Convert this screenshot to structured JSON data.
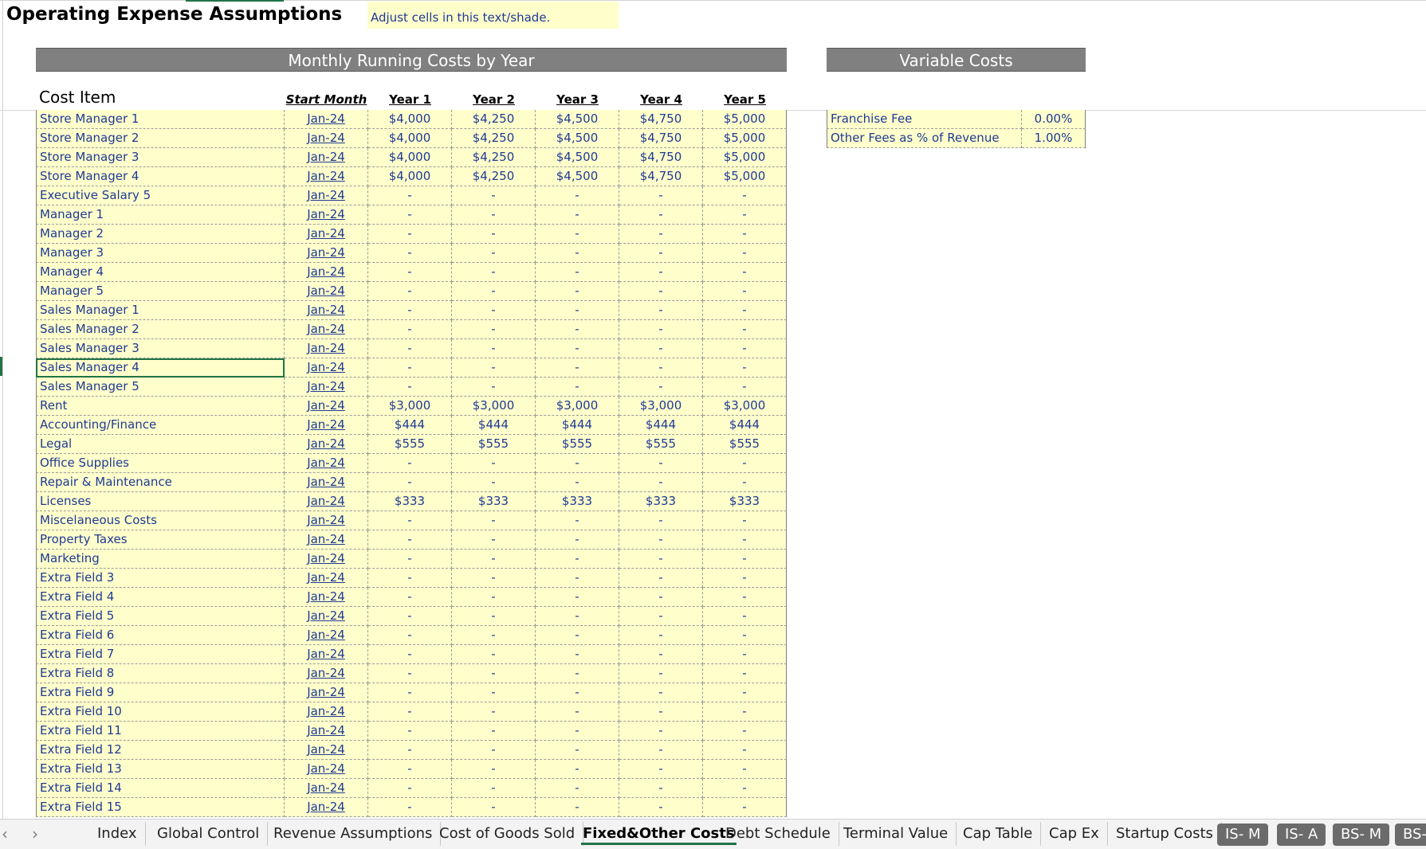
{
  "title": "Operating Expense Assumptions",
  "note": "Adjust cells in this text/shade.",
  "main_header": "Monthly Running Costs by Year",
  "variable_header": "Variable Costs",
  "columns": {
    "cost_item": "Cost Item",
    "start_month": "Start Month",
    "years": [
      "Year 1",
      "Year 2",
      "Year 3",
      "Year 4",
      "Year 5"
    ]
  },
  "rows": [
    {
      "name": "Store Manager 1",
      "start": "Jan-24",
      "values": [
        "$4,000",
        "$4,250",
        "$4,500",
        "$4,750",
        "$5,000"
      ]
    },
    {
      "name": "Store Manager 2",
      "start": "Jan-24",
      "values": [
        "$4,000",
        "$4,250",
        "$4,500",
        "$4,750",
        "$5,000"
      ]
    },
    {
      "name": "Store Manager 3",
      "start": "Jan-24",
      "values": [
        "$4,000",
        "$4,250",
        "$4,500",
        "$4,750",
        "$5,000"
      ]
    },
    {
      "name": "Store Manager 4",
      "start": "Jan-24",
      "values": [
        "$4,000",
        "$4,250",
        "$4,500",
        "$4,750",
        "$5,000"
      ]
    },
    {
      "name": "Executive Salary 5",
      "start": "Jan-24",
      "values": [
        "-",
        "-",
        "-",
        "-",
        "-"
      ]
    },
    {
      "name": "Manager 1",
      "start": "Jan-24",
      "values": [
        "-",
        "-",
        "-",
        "-",
        "-"
      ]
    },
    {
      "name": "Manager 2",
      "start": "Jan-24",
      "values": [
        "-",
        "-",
        "-",
        "-",
        "-"
      ]
    },
    {
      "name": "Manager 3",
      "start": "Jan-24",
      "values": [
        "-",
        "-",
        "-",
        "-",
        "-"
      ]
    },
    {
      "name": "Manager 4",
      "start": "Jan-24",
      "values": [
        "-",
        "-",
        "-",
        "-",
        "-"
      ]
    },
    {
      "name": "Manager 5",
      "start": "Jan-24",
      "values": [
        "-",
        "-",
        "-",
        "-",
        "-"
      ]
    },
    {
      "name": "Sales Manager 1",
      "start": "Jan-24",
      "values": [
        "-",
        "-",
        "-",
        "-",
        "-"
      ]
    },
    {
      "name": "Sales Manager 2",
      "start": "Jan-24",
      "values": [
        "-",
        "-",
        "-",
        "-",
        "-"
      ]
    },
    {
      "name": "Sales Manager 3",
      "start": "Jan-24",
      "values": [
        "-",
        "-",
        "-",
        "-",
        "-"
      ]
    },
    {
      "name": "Sales Manager 4",
      "start": "Jan-24",
      "values": [
        "-",
        "-",
        "-",
        "-",
        "-"
      ],
      "selected": true
    },
    {
      "name": "Sales Manager 5",
      "start": "Jan-24",
      "values": [
        "-",
        "-",
        "-",
        "-",
        "-"
      ]
    },
    {
      "name": "Rent",
      "start": "Jan-24",
      "values": [
        "$3,000",
        "$3,000",
        "$3,000",
        "$3,000",
        "$3,000"
      ]
    },
    {
      "name": "Accounting/Finance",
      "start": "Jan-24",
      "values": [
        "$444",
        "$444",
        "$444",
        "$444",
        "$444"
      ]
    },
    {
      "name": "Legal",
      "start": "Jan-24",
      "values": [
        "$555",
        "$555",
        "$555",
        "$555",
        "$555"
      ]
    },
    {
      "name": "Office Supplies",
      "start": "Jan-24",
      "values": [
        "-",
        "-",
        "-",
        "-",
        "-"
      ]
    },
    {
      "name": "Repair & Maintenance",
      "start": "Jan-24",
      "values": [
        "-",
        "-",
        "-",
        "-",
        "-"
      ]
    },
    {
      "name": "Licenses",
      "start": "Jan-24",
      "values": [
        "$333",
        "$333",
        "$333",
        "$333",
        "$333"
      ]
    },
    {
      "name": "Miscelaneous Costs",
      "start": "Jan-24",
      "values": [
        "-",
        "-",
        "-",
        "-",
        "-"
      ]
    },
    {
      "name": "Property Taxes",
      "start": "Jan-24",
      "values": [
        "-",
        "-",
        "-",
        "-",
        "-"
      ]
    },
    {
      "name": "Marketing",
      "start": "Jan-24",
      "values": [
        "-",
        "-",
        "-",
        "-",
        "-"
      ]
    },
    {
      "name": "Extra Field 3",
      "start": "Jan-24",
      "values": [
        "-",
        "-",
        "-",
        "-",
        "-"
      ]
    },
    {
      "name": "Extra Field 4",
      "start": "Jan-24",
      "values": [
        "-",
        "-",
        "-",
        "-",
        "-"
      ]
    },
    {
      "name": "Extra Field 5",
      "start": "Jan-24",
      "values": [
        "-",
        "-",
        "-",
        "-",
        "-"
      ]
    },
    {
      "name": "Extra Field 6",
      "start": "Jan-24",
      "values": [
        "-",
        "-",
        "-",
        "-",
        "-"
      ]
    },
    {
      "name": "Extra Field 7",
      "start": "Jan-24",
      "values": [
        "-",
        "-",
        "-",
        "-",
        "-"
      ]
    },
    {
      "name": "Extra Field 8",
      "start": "Jan-24",
      "values": [
        "-",
        "-",
        "-",
        "-",
        "-"
      ]
    },
    {
      "name": "Extra Field 9",
      "start": "Jan-24",
      "values": [
        "-",
        "-",
        "-",
        "-",
        "-"
      ]
    },
    {
      "name": "Extra Field 10",
      "start": "Jan-24",
      "values": [
        "-",
        "-",
        "-",
        "-",
        "-"
      ]
    },
    {
      "name": "Extra Field 11",
      "start": "Jan-24",
      "values": [
        "-",
        "-",
        "-",
        "-",
        "-"
      ]
    },
    {
      "name": "Extra Field 12",
      "start": "Jan-24",
      "values": [
        "-",
        "-",
        "-",
        "-",
        "-"
      ]
    },
    {
      "name": "Extra Field 13",
      "start": "Jan-24",
      "values": [
        "-",
        "-",
        "-",
        "-",
        "-"
      ]
    },
    {
      "name": "Extra Field 14",
      "start": "Jan-24",
      "values": [
        "-",
        "-",
        "-",
        "-",
        "-"
      ]
    },
    {
      "name": "Extra Field 15",
      "start": "Jan-24",
      "values": [
        "-",
        "-",
        "-",
        "-",
        "-"
      ]
    }
  ],
  "variable_costs": [
    {
      "name": "Franchise Fee",
      "value": "0.00%"
    },
    {
      "name": "Other Fees as % of Revenue",
      "value": "1.00%"
    }
  ],
  "tabs": [
    {
      "label": "Index"
    },
    {
      "label": "Global Control"
    },
    {
      "label": "Revenue Assumptions"
    },
    {
      "label": "Cost of Goods Sold"
    },
    {
      "label": "Fixed&Other Costs",
      "active": true
    },
    {
      "label": "Debt Schedule"
    },
    {
      "label": "Terminal Value"
    },
    {
      "label": "Cap Table"
    },
    {
      "label": "Cap Ex"
    },
    {
      "label": "Startup Costs"
    },
    {
      "label": "IS- M",
      "dark": true
    },
    {
      "label": "IS- A",
      "dark": true
    },
    {
      "label": "BS- M",
      "dark": true
    },
    {
      "label": "BS-",
      "dark": true
    }
  ],
  "nav": {
    "prev": "‹",
    "next": "›"
  },
  "colors": {
    "input_fill": "#ffffcc",
    "input_text": "#1f3a93",
    "header_fill": "#808080",
    "accent": "#217346"
  }
}
